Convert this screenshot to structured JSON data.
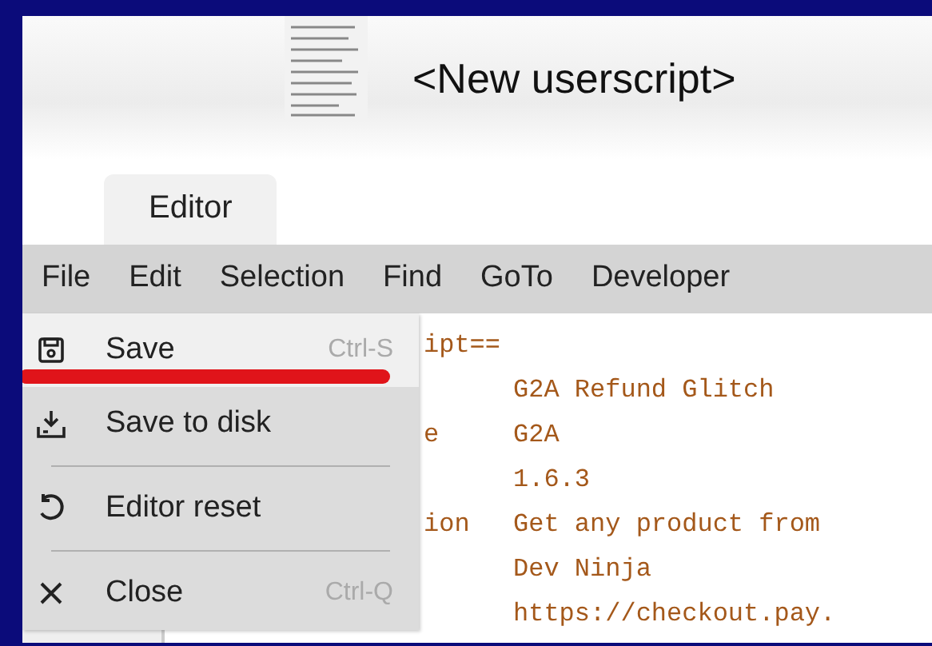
{
  "header": {
    "title": "<New userscript>"
  },
  "tabs": [
    {
      "label": "Editor",
      "selected": true
    }
  ],
  "menubar": [
    {
      "label": "File"
    },
    {
      "label": "Edit"
    },
    {
      "label": "Selection"
    },
    {
      "label": "Find"
    },
    {
      "label": "GoTo"
    },
    {
      "label": "Developer"
    }
  ],
  "file_menu": [
    {
      "kind": "save",
      "label": "Save",
      "shortcut": "Ctrl-S",
      "selected": true,
      "underlined": true
    },
    {
      "kind": "download",
      "label": "Save to disk",
      "selected": false,
      "underlined": false
    },
    {
      "kind": "divider"
    },
    {
      "kind": "reset",
      "label": "Editor reset",
      "selected": false,
      "underlined": false
    },
    {
      "kind": "divider"
    },
    {
      "kind": "close",
      "label": "Close",
      "shortcut": "Ctrl-Q",
      "selected": false,
      "underlined": false
    }
  ],
  "code_lines": [
    {
      "kind": "partial",
      "key": "ipt=="
    },
    {
      "kind": "partial",
      "value": "G2A Refund Glitch"
    },
    {
      "kind": "partial",
      "key": "e",
      "value": "G2A"
    },
    {
      "kind": "partial",
      "value": "1.6.3"
    },
    {
      "kind": "partial",
      "key": "ion",
      "value": "Get any product from"
    },
    {
      "kind": "partial",
      "value": "Dev Ninja"
    },
    {
      "kind": "partial",
      "value": "https://checkout.pay."
    }
  ]
}
